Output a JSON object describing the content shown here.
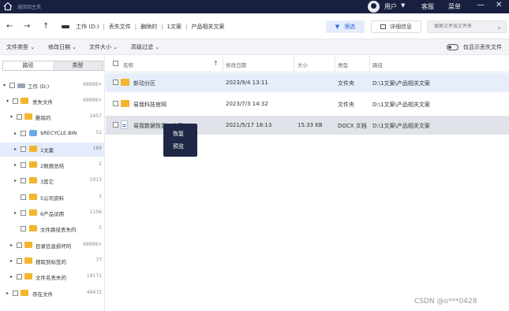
{
  "topbar": {
    "back_label": "返回到主页",
    "user": "用户",
    "service": "客服",
    "menu": "菜单",
    "minimize": "—",
    "close": "✕"
  },
  "navbar": {
    "back": "←",
    "forward": "→",
    "up": "↑",
    "breadcrumb": [
      "工作 (D:)",
      "丢失文件",
      "删除的",
      "1文案",
      "产品相关文案"
    ],
    "filter_label": "筛选",
    "detail_label": "详细信息",
    "search_placeholder": "搜索文件或文件夹"
  },
  "filterbar": {
    "items": [
      "文件类型 ⌄",
      "修改日期 ⌄",
      "文件大小 ⌄",
      "高级过滤 ⌄"
    ],
    "toggle_label": "仅显示丢失文件"
  },
  "leftpanel": {
    "tabs": [
      "路径",
      "类型"
    ],
    "tree": [
      {
        "label": "工作 (D:)",
        "count": "99999+"
      },
      {
        "label": "丢失文件",
        "count": "99999+"
      },
      {
        "label": "删除的",
        "count": "2457"
      },
      {
        "label": "$RECYCLE.BIN",
        "count": "51"
      },
      {
        "label": "1文案",
        "count": "184"
      },
      {
        "label": "2数据总结",
        "count": "2"
      },
      {
        "label": "3其它",
        "count": "1013"
      },
      {
        "label": "5公司资料",
        "count": "2"
      },
      {
        "label": "6产品试用",
        "count": "1156"
      },
      {
        "label": "文件路径丢失的",
        "count": "5"
      },
      {
        "label": "目录信息损坏的",
        "count": "99999+"
      },
      {
        "label": "搜取到标签的",
        "count": "77"
      },
      {
        "label": "文件名丢失的",
        "count": "19171"
      },
      {
        "label": "存在文件",
        "count": "49472"
      }
    ]
  },
  "table": {
    "headers": [
      "名称",
      "修改日期",
      "大小",
      "类型",
      "路径"
    ],
    "rows": [
      {
        "name": "新动分区",
        "date": "2023/9/4 13:11",
        "size": "",
        "type": "文件夹",
        "path": "D:\\1文案\\产品相关文案"
      },
      {
        "name": "易我科技官网",
        "date": "2023/7/3 14:32",
        "size": "",
        "type": "文件夹",
        "path": "D:\\1文案\\产品相关文案"
      },
      {
        "name": "易我数据恢复…文案.docx",
        "date": "2021/5/17 18:13",
        "size": "15.33 KB",
        "type": "DOCX 文档",
        "path": "D:\\1文案\\产品相关文案"
      }
    ]
  },
  "context_menu": {
    "items": [
      "恢复",
      "预览"
    ]
  },
  "watermark": "CSDN @o***0428",
  "colors": {
    "topbar": "#19203f",
    "accent": "#2b63d9",
    "folder": "#f2b52c",
    "selected_row": "#e6eefb"
  }
}
